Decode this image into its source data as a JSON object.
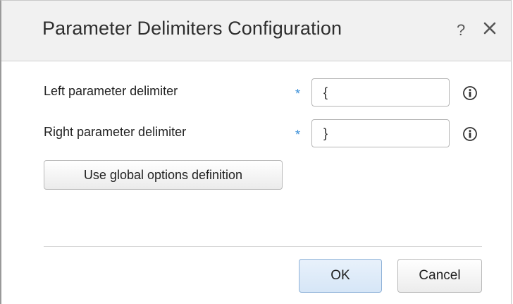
{
  "dialog": {
    "title": "Parameter Delimiters Configuration",
    "help_label": "?",
    "close_icon": "close-icon"
  },
  "form": {
    "rows": [
      {
        "label": "Left parameter delimiter",
        "required_mark": "*",
        "value": "{",
        "info_icon": "info-icon"
      },
      {
        "label": "Right parameter delimiter",
        "required_mark": "*",
        "value": "}",
        "info_icon": "info-icon"
      }
    ],
    "global_button_label": "Use global options definition"
  },
  "footer": {
    "ok_label": "OK",
    "cancel_label": "Cancel"
  },
  "colors": {
    "required_mark": "#3a8fd8",
    "ok_border": "#8fb2d8",
    "title_bar_bg": "#f1f1f1"
  }
}
